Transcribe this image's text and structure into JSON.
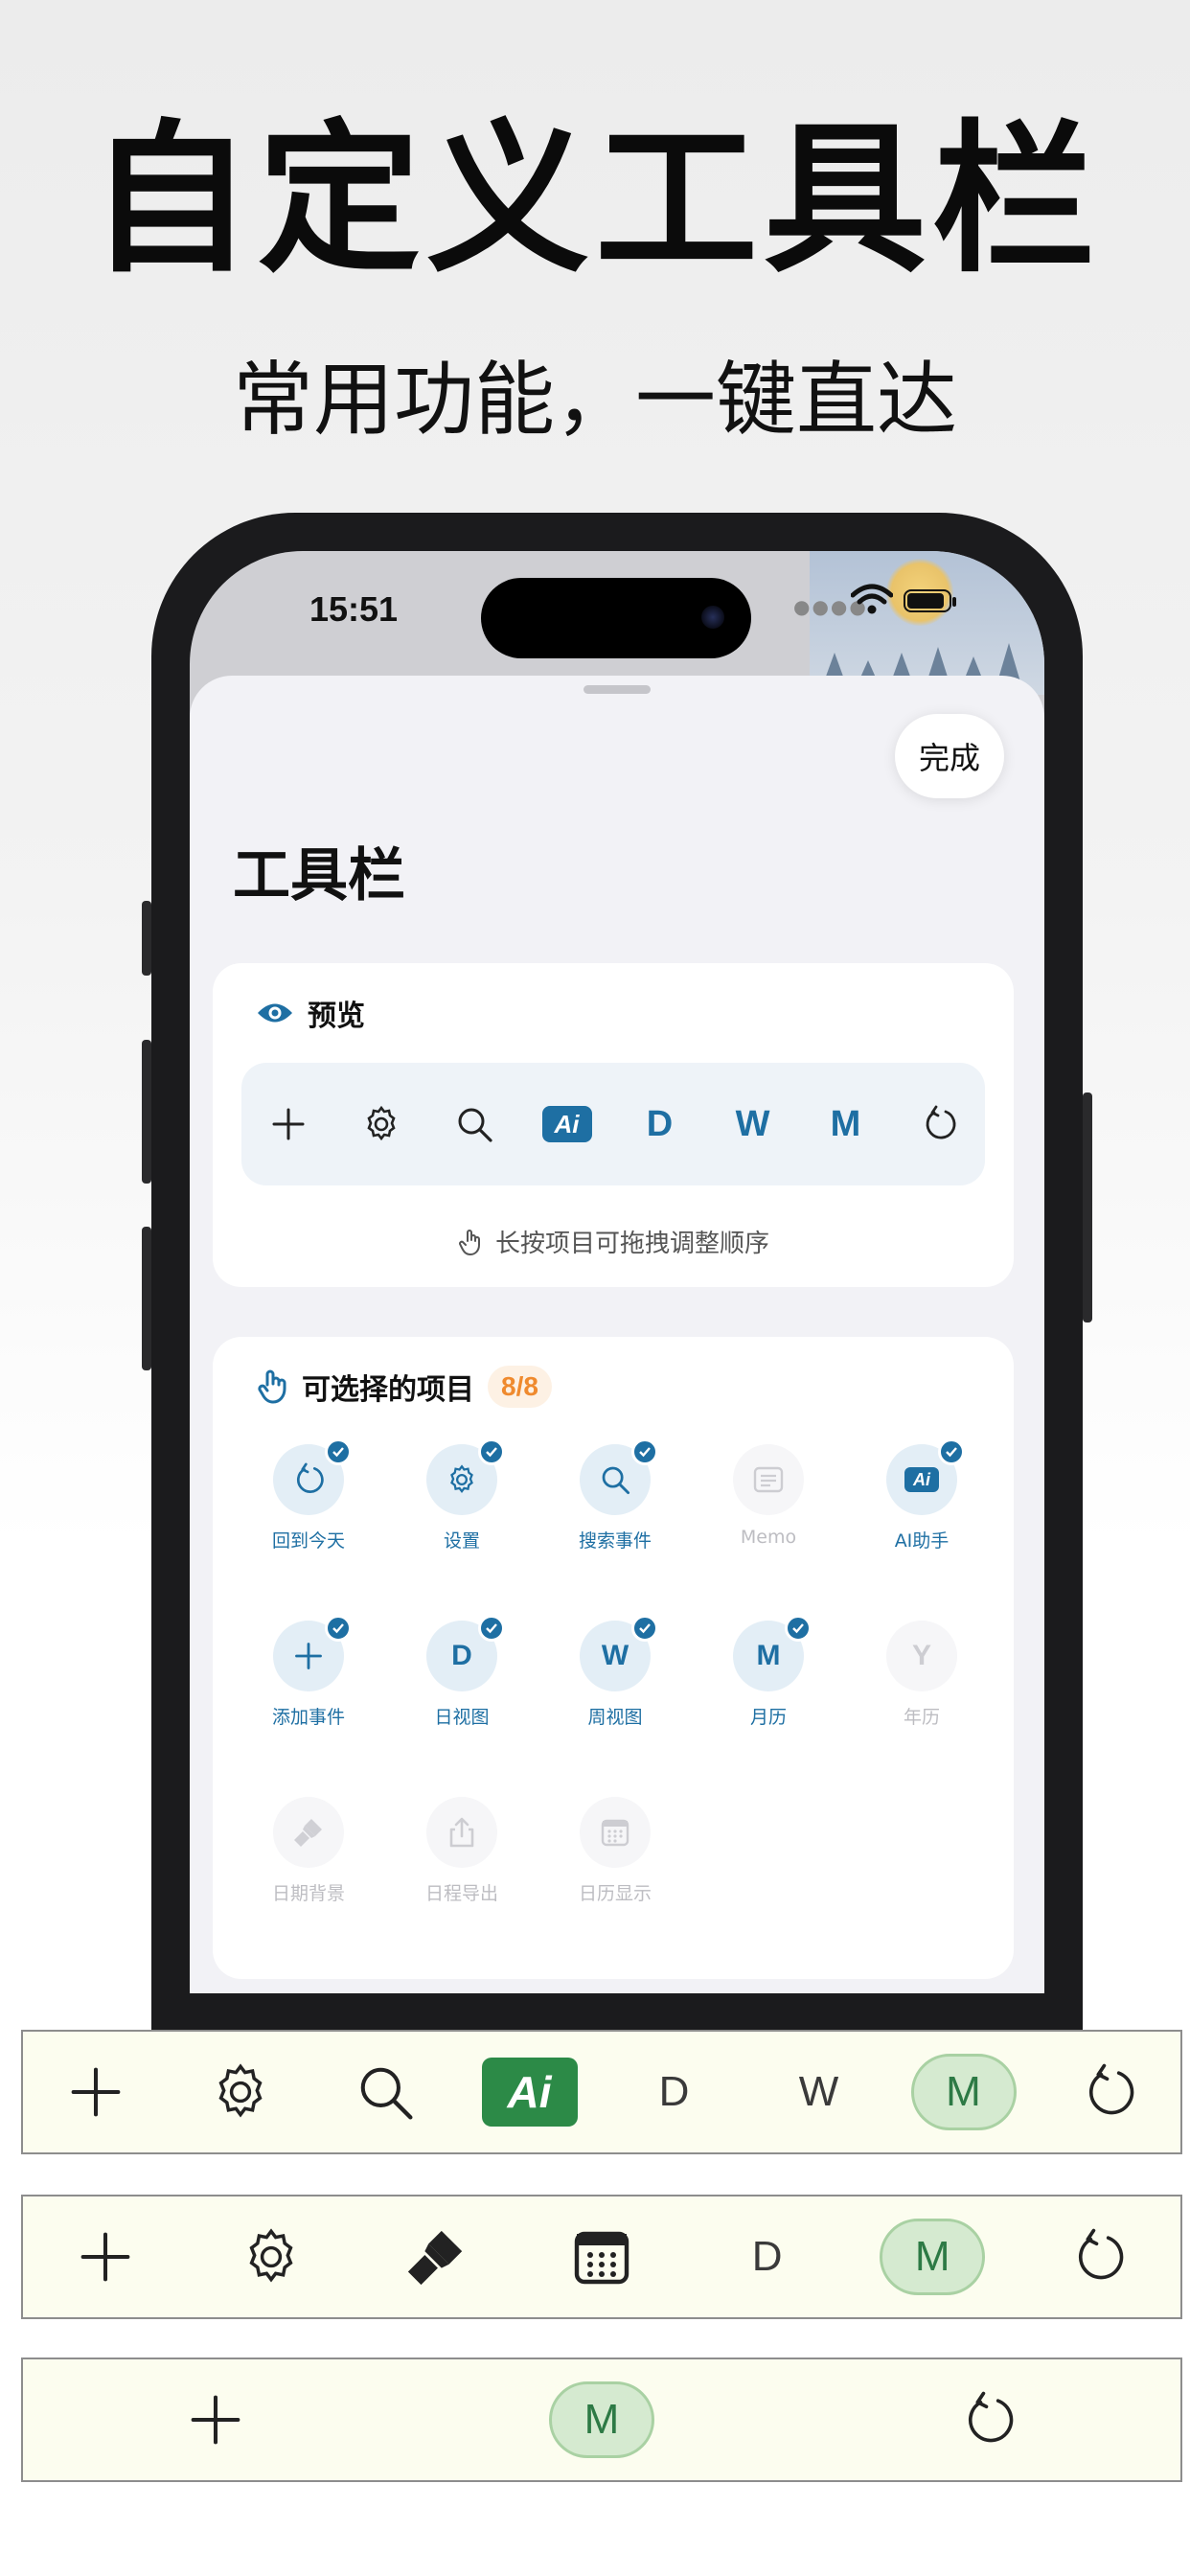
{
  "promo": {
    "headline": "自定义工具栏",
    "subhead": "常用功能，一键直达"
  },
  "status_bar": {
    "time": "15:51"
  },
  "sheet": {
    "done_label": "完成",
    "title": "工具栏",
    "preview": {
      "header": "预览",
      "toolbar": [
        {
          "icon": "plus-icon"
        },
        {
          "icon": "gear-icon"
        },
        {
          "icon": "search-icon"
        },
        {
          "icon": "ai-icon",
          "text": "Ai"
        },
        {
          "icon": "letter",
          "text": "D"
        },
        {
          "icon": "letter",
          "text": "W"
        },
        {
          "icon": "letter",
          "text": "M"
        },
        {
          "icon": "today-icon"
        }
      ],
      "hint": "长按项目可拖拽调整顺序"
    },
    "options": {
      "header": "可选择的项目",
      "count": "8/8",
      "items": [
        {
          "label": "回到今天",
          "icon": "today-icon",
          "selected": true
        },
        {
          "label": "设置",
          "icon": "gear-icon",
          "selected": true
        },
        {
          "label": "搜索事件",
          "icon": "search-icon",
          "selected": true
        },
        {
          "label": "Memo",
          "icon": "memo-icon",
          "selected": false
        },
        {
          "label": "AI助手",
          "icon": "ai-icon",
          "text": "Ai",
          "selected": true
        },
        {
          "label": "添加事件",
          "icon": "plus-icon",
          "selected": true
        },
        {
          "label": "日视图",
          "icon": "letter",
          "text": "D",
          "selected": true
        },
        {
          "label": "周视图",
          "icon": "letter",
          "text": "W",
          "selected": true
        },
        {
          "label": "月历",
          "icon": "letter",
          "text": "M",
          "selected": true
        },
        {
          "label": "年历",
          "icon": "letter",
          "text": "Y",
          "selected": false
        },
        {
          "label": "日期背景",
          "icon": "brush-icon",
          "selected": false
        },
        {
          "label": "日程导出",
          "icon": "share-icon",
          "selected": false
        },
        {
          "label": "日历显示",
          "icon": "calendar-icon",
          "selected": false
        }
      ]
    }
  },
  "sample_bars": [
    {
      "items": [
        "plus-icon",
        "gear-icon",
        "search-icon",
        "Ai",
        "D",
        "W",
        "M",
        "today-icon"
      ],
      "highlight": "M"
    },
    {
      "items": [
        "plus-icon",
        "gear-icon",
        "brush-icon",
        "calendar-icon",
        "D",
        "M",
        "today-icon"
      ],
      "highlight": "M"
    },
    {
      "items": [
        "plus-icon",
        "M",
        "today-icon"
      ],
      "highlight": "M"
    }
  ],
  "colors": {
    "accent": "#1e6fa3",
    "badge": "#ef8a2e",
    "sample_bar_bg": "#fcfdef",
    "green": "#2c8a47"
  }
}
